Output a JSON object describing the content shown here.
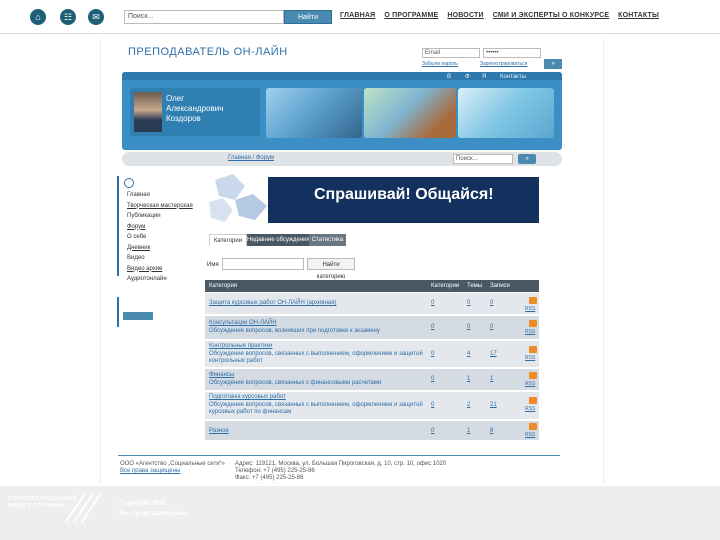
{
  "topbar": {
    "search_placeholder": "Поиск...",
    "search_button": "Найти",
    "nav": [
      "ГЛАВНАЯ",
      "О ПРОГРАММЕ",
      "НОВОСТИ",
      "СМИ И ЭКСПЕРТЫ О КОНКУРСЕ",
      "КОНТАКТЫ"
    ]
  },
  "site": {
    "title": "ПРЕПОДАВАТЕЛЬ ОН-ЛАЙН",
    "login_placeholder": "Email",
    "password_value": "••••••",
    "forgot_link": "Забыли пароль",
    "register_link": "Зарегистрироваться",
    "login_button": "»"
  },
  "banner": {
    "links": [
      "В",
      "Ф",
      "Я",
      "Контакты"
    ],
    "person_name": [
      "Олег",
      "Александрович",
      "Коздоров"
    ]
  },
  "breadcrumb": "Главная / Форум",
  "search2": {
    "placeholder": "Поиск...",
    "button": "»"
  },
  "sidebar": {
    "menu": [
      "Главная",
      "Творческая мастерская",
      "Публикации",
      "Форум",
      "О себе",
      "Дневник",
      "Видео",
      "Видео архив",
      "Аудиотонлайн"
    ]
  },
  "hero": {
    "text": "Спрашивай! Общайся!"
  },
  "tabs": [
    "Категории",
    "Недавние обсуждения",
    "Статистика"
  ],
  "category_search": {
    "label": "Имя",
    "button": "Найти категорию"
  },
  "table": {
    "headers": [
      "Категория",
      "Категории",
      "Темы",
      "Записи"
    ],
    "rows": [
      {
        "title": "Защита курсовых работ ОН-ЛАЙН (архивная)",
        "desc": "",
        "cats": "0",
        "topics": "0",
        "posts": "0",
        "rss": "RSS"
      },
      {
        "title": "Консультации ОН-ЛАЙН",
        "desc": "Обсуждение вопросов, возникших при подготовке к экзамену",
        "cats": "0",
        "topics": "0",
        "posts": "0",
        "rss": "RSS"
      },
      {
        "title": "Контрольные практики",
        "desc": "Обсуждение вопросов, связанных с выполнением, оформлением и защитой контрольных работ",
        "cats": "0",
        "topics": "4",
        "posts": "17",
        "rss": "RSS"
      },
      {
        "title": "Финансы",
        "desc": "Обсуждение вопросов, связанных с финансовыми расчетами",
        "cats": "0",
        "topics": "1",
        "posts": "1",
        "rss": "RSS"
      },
      {
        "title": "Подготовка курсовых работ",
        "desc": "Обсуждение вопросов, связанных с выполнением, оформлением и защитой курсовых работ по финансам",
        "cats": "0",
        "topics": "2",
        "posts": "21",
        "rss": "RSS"
      },
      {
        "title": "Разное",
        "desc": "",
        "cats": "0",
        "topics": "1",
        "posts": "8",
        "rss": "RSS"
      }
    ]
  },
  "footer": {
    "left": [
      "ООО «Агентство „Социальные сети“»",
      "Все права защищены"
    ],
    "right": [
      "Адрес: 119121, Москва, ул. Большая Пироговская, д. 10, стр. 10, офис 1020",
      "Телефон: +7 (495) 225-25-86",
      "Факс: +7 (495) 225-25-86"
    ]
  },
  "bottom": {
    "fund": [
      "БЛАГОТВОРИТЕЛЬНЫЙ",
      "ФОНД В.ПОТАНИНА"
    ],
    "copyright": [
      "Copyright 2010",
      "Все права защищены"
    ]
  },
  "colors": {
    "accent": "#2f6fa8",
    "banner": "#3b8fc4",
    "hero": "#12315e",
    "table_header": "#4a5863"
  }
}
